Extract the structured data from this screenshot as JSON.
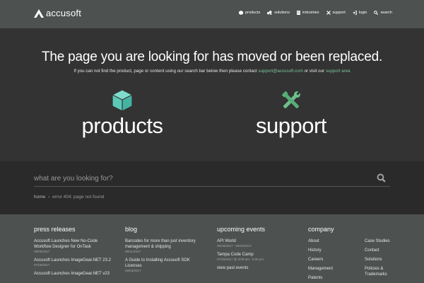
{
  "header": {
    "logo_text": "accusoft",
    "nav": [
      {
        "label": "products",
        "icon": "cube-icon"
      },
      {
        "label": "solutions",
        "icon": "solutions-icon"
      },
      {
        "label": "industries",
        "icon": "building-icon"
      },
      {
        "label": "support",
        "icon": "tools-icon"
      },
      {
        "label": "login",
        "icon": "login-icon"
      },
      {
        "label": "search",
        "icon": "search-icon"
      }
    ]
  },
  "hero": {
    "title": "The page you are looking for has moved or been replaced.",
    "subtitle_prefix": "If you can not find the product, page or content using our search bar below then please contact ",
    "support_email": "support@accusoft.com",
    "subtitle_middle": " or visit our ",
    "support_area_link": "support area",
    "tiles": [
      {
        "label": "products",
        "icon": "cube-icon",
        "color": "#5bc8b8"
      },
      {
        "label": "support",
        "icon": "tools-icon",
        "color": "#6cc08a"
      }
    ]
  },
  "search": {
    "placeholder": "what are you looking for?",
    "breadcrumb_home": "home",
    "breadcrumb_separator": "›",
    "breadcrumb_current": "error 404: page not found"
  },
  "footer": {
    "press": {
      "title": "press releases",
      "items": [
        {
          "title": "Accusoft Launches New No-Code Workflow Designer for OnTask",
          "date": "08/06/2017"
        },
        {
          "title": "Accusoft Launches ImageGear.NET 23.2",
          "date": "07/26/2017"
        },
        {
          "title": "Accusoft Launches ImageGear.NET v23",
          "date": ""
        }
      ]
    },
    "blog": {
      "title": "blog",
      "items": [
        {
          "title": "Barcodes for more than just inventory management & shipping",
          "date": "08/11/2017"
        },
        {
          "title": "A Guide to Installing Accusoft SDK Licenses",
          "date": "08/03/2017"
        }
      ]
    },
    "events": {
      "title": "upcoming events",
      "items": [
        {
          "title": "API World",
          "date": "09/18/2017 - 09/20/2017"
        },
        {
          "title": "Tampa Code Camp",
          "date": "07/29/2017 @ 8:00 am - 5:00 pm"
        }
      ],
      "view_past": "view past events"
    },
    "company": {
      "title": "company",
      "col1": [
        "About",
        "History",
        "Careers",
        "Management",
        "Patents"
      ],
      "col2": [
        "Case Studies",
        "Contact",
        "Solutions",
        "Policies & Trademarks"
      ]
    }
  }
}
